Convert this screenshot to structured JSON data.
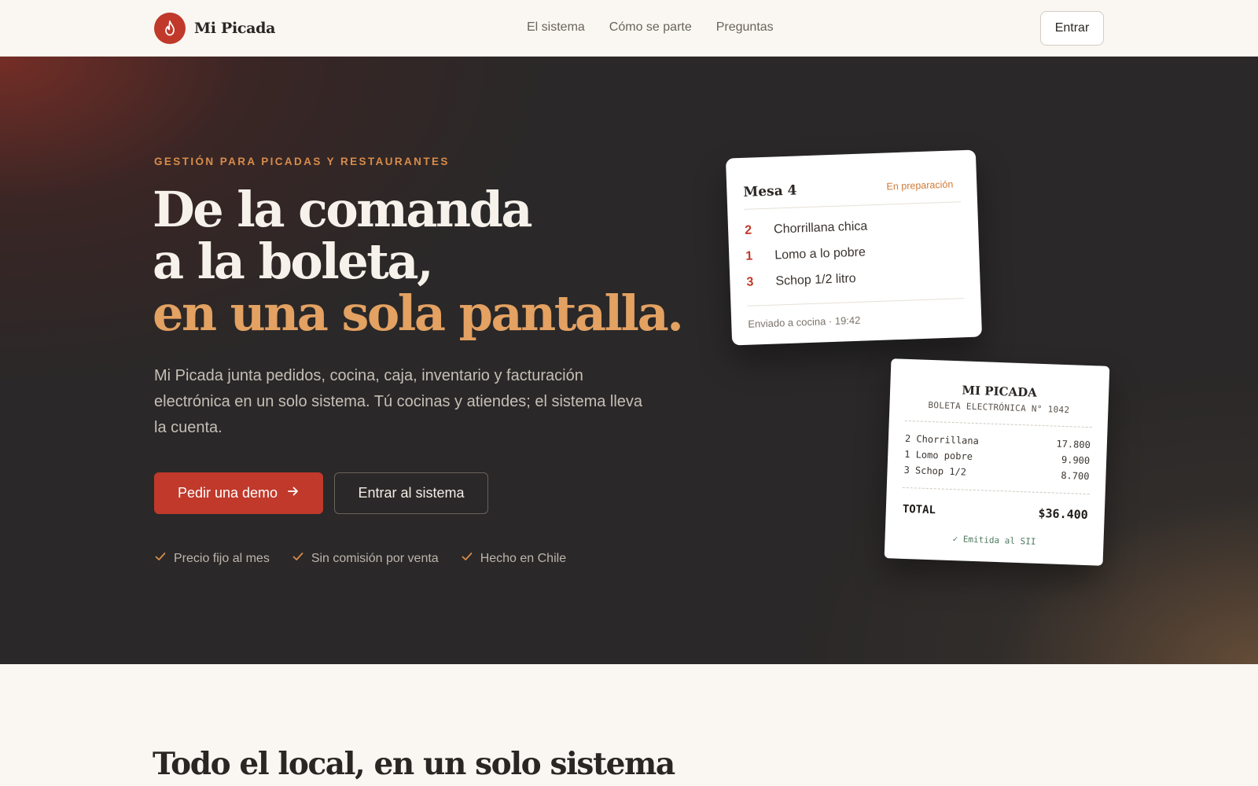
{
  "nav": {
    "brand": "Mi Picada",
    "links": [
      "El sistema",
      "Cómo se parte",
      "Preguntas"
    ],
    "login_label": "Entrar"
  },
  "hero": {
    "eyebrow": "GESTIÓN PARA PICADAS Y RESTAURANTES",
    "headline_line1": "De la comanda",
    "headline_line2": "a la boleta,",
    "headline_line3": "en una sola pantalla.",
    "lead": "Mi Picada junta pedidos, cocina, caja, inventario y facturación electrónica en un solo sistema. Tú cocinas y atiendes; el sistema lleva la cuenta.",
    "cta_primary": "Pedir una demo",
    "cta_secondary": "Entrar al sistema",
    "checks": [
      "Precio fijo al mes",
      "Sin comisión por venta",
      "Hecho en Chile"
    ]
  },
  "order_card": {
    "title": "Mesa 4",
    "status": "En preparación",
    "items": [
      {
        "qty": "2",
        "name": "Chorrillana chica"
      },
      {
        "qty": "1",
        "name": "Lomo a lo pobre"
      },
      {
        "qty": "3",
        "name": "Schop 1/2 litro"
      }
    ],
    "footer": "Enviado a cocina · 19:42"
  },
  "receipt": {
    "title": "MI PICADA",
    "subtitle": "BOLETA ELECTRÓNICA N° 1042",
    "lines": [
      {
        "desc": "2 Chorrillana",
        "amount": "17.800"
      },
      {
        "desc": "1 Lomo pobre",
        "amount": "9.900"
      },
      {
        "desc": "3 Schop 1/2",
        "amount": "8.700"
      }
    ],
    "total_label": "TOTAL",
    "total_amount": "$36.400",
    "status": "✓ Emitida al SII"
  },
  "section": {
    "title": "Todo el local, en un solo sistema"
  },
  "colors": {
    "brand_red": "#c0392b",
    "accent_orange": "#e3a162",
    "hero_bg": "#2a2828",
    "page_bg": "#faf7f2"
  },
  "icons": {
    "logo": "flame-icon",
    "cta": "arrow-right-icon",
    "check": "check-icon"
  }
}
